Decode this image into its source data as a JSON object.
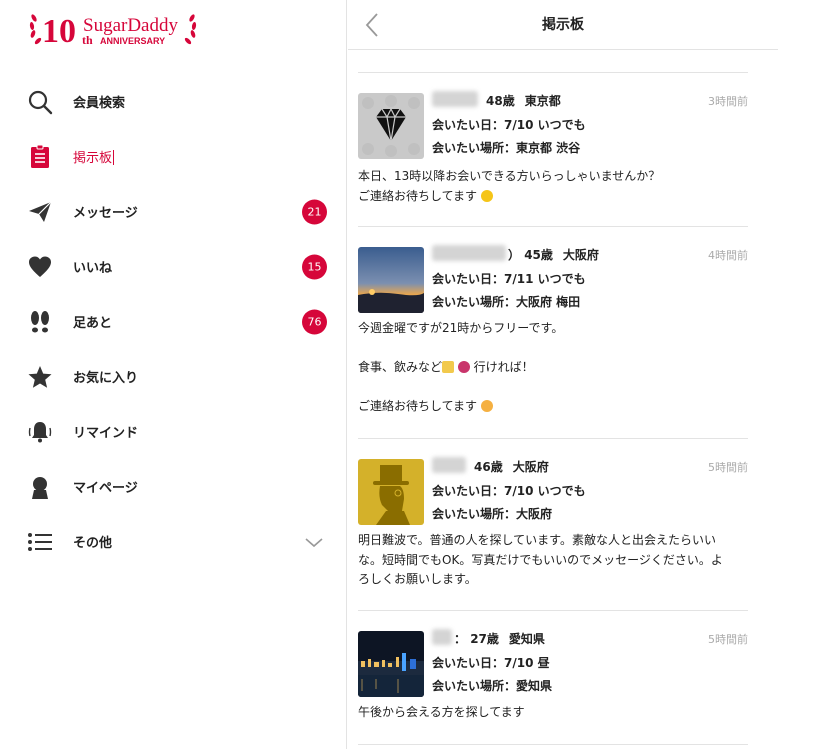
{
  "logo": {
    "text": "SugarDaddy",
    "anniversary_number": "10",
    "anniversary_suffix": "th",
    "anniversary_label": "ANNIVERSARY"
  },
  "sidebar": {
    "items": [
      {
        "label": "会員検索",
        "icon": "search-icon",
        "badge": null
      },
      {
        "label": "掲示板",
        "icon": "board-icon",
        "badge": null,
        "active": true
      },
      {
        "label": "メッセージ",
        "icon": "paper-plane-icon",
        "badge": "21"
      },
      {
        "label": "いいね",
        "icon": "heart-icon",
        "badge": "15"
      },
      {
        "label": "足あと",
        "icon": "footprints-icon",
        "badge": "76"
      },
      {
        "label": "お気に入り",
        "icon": "star-icon",
        "badge": null
      },
      {
        "label": "リマインド",
        "icon": "bell-icon",
        "badge": null
      },
      {
        "label": "マイページ",
        "icon": "person-icon",
        "badge": null
      },
      {
        "label": "その他",
        "icon": "list-icon",
        "badge": null,
        "expandable": true
      }
    ]
  },
  "header": {
    "title": "掲示板"
  },
  "posts": [
    {
      "age": "48歳",
      "prefecture": "東京都",
      "time": "3時間前",
      "date_line": "会いたい日：7/10 いつでも",
      "place_line": "会いたい場所：東京都 渋谷",
      "body_lines": [
        "本日、13時以降お会いできる方いらっしゃいませんか？",
        "ご連絡お待ちしてます"
      ],
      "thumb": "diamond-thumbnail"
    },
    {
      "name_suffix": "）",
      "age": "45歳",
      "prefecture": "大阪府",
      "time": "4時間前",
      "date_line": "会いたい日：7/11 いつでも",
      "place_line": "会いたい場所：大阪府 梅田",
      "body_lines": [
        "今週金曜ですが21時からフリーです。",
        "",
        "食事、飲みなど",
        "",
        "ご連絡お待ちしてます"
      ],
      "body_suffix": "行ければ！",
      "thumb": "sunset-thumbnail"
    },
    {
      "age": "46歳",
      "prefecture": "大阪府",
      "time": "5時間前",
      "date_line": "会いたい日：7/10 いつでも",
      "place_line": "会いたい場所：大阪府",
      "body_lines": [
        "明日難波で。普通の人を探しています。素敵な人と出会えたらいい",
        "な。短時間でもOK。写真だけでもいいのでメッセージください。よ",
        "ろしくお願いします。"
      ],
      "thumb": "gentleman-thumbnail"
    },
    {
      "name_suffix": "：",
      "age": "27歳",
      "prefecture": "愛知県",
      "time": "5時間前",
      "date_line": "会いたい日：7/10 昼",
      "place_line": "会いたい場所：愛知県",
      "body_lines": [
        "午後から会える方を探してます"
      ],
      "thumb": "night-city-thumbnail"
    }
  ],
  "colors": {
    "accent": "#d6063a",
    "text": "#222222",
    "muted": "#aaaaaa",
    "divider": "#e3e3e3"
  }
}
